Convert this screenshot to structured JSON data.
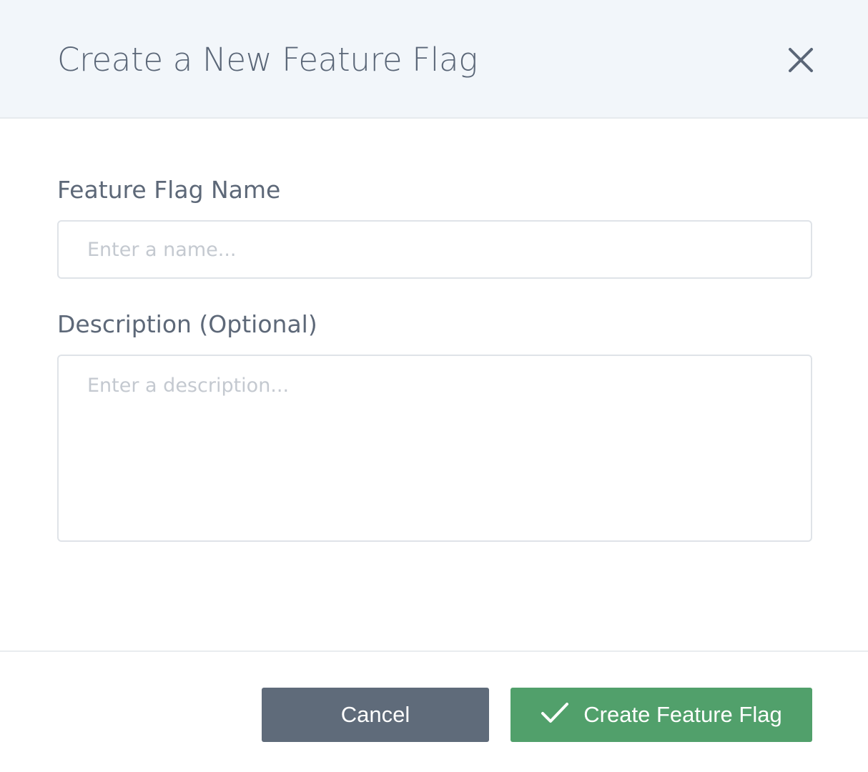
{
  "dialog": {
    "title": "Create a New Feature Flag",
    "close_icon": "close-icon"
  },
  "form": {
    "name": {
      "label": "Feature Flag Name",
      "placeholder": "Enter a name...",
      "value": ""
    },
    "description": {
      "label": "Description (Optional)",
      "placeholder": "Enter a description...",
      "value": ""
    }
  },
  "footer": {
    "cancel_label": "Cancel",
    "create_label": "Create Feature Flag",
    "create_icon": "check-icon"
  },
  "colors": {
    "header_bg": "#f2f6fa",
    "title_text": "#5a6677",
    "cancel_bg": "#5f6b7a",
    "create_bg": "#51a06b"
  }
}
